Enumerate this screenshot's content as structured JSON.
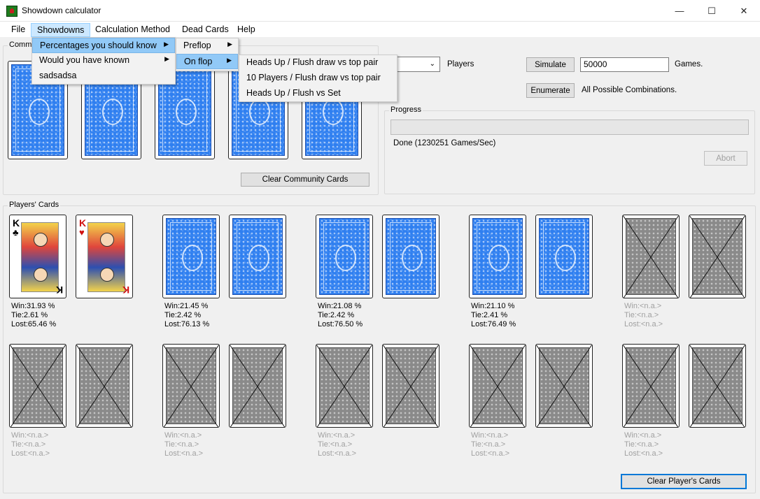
{
  "window": {
    "title": "Showdown calculator",
    "minimize": "—",
    "maximize": "☐",
    "close": "✕"
  },
  "menubar": [
    "File",
    "Showdowns",
    "Calculation Method",
    "Dead Cards",
    "Help"
  ],
  "menus": {
    "showdowns": [
      "Percentages you should know",
      "Would you have known",
      "sadsadsa"
    ],
    "percentages": [
      "Preflop",
      "On flop"
    ],
    "on_flop": [
      "Heads Up / Flush draw vs top pair",
      "10 Players / Flush draw vs top pair",
      "Heads Up / Flush vs Set"
    ]
  },
  "community": {
    "label": "Commu",
    "clear_button": "Clear Community Cards",
    "cards": [
      "back",
      "back",
      "back",
      "back",
      "back"
    ]
  },
  "controls": {
    "players_label": "Players",
    "simulate_button": "Simulate",
    "games_value": "50000",
    "games_label": "Games.",
    "enumerate_button": "Enumerate",
    "enumerate_label": "All Possible Combinations."
  },
  "progress": {
    "label": "Progress",
    "fraction": 0,
    "status": "Done (1230251 Games/Sec)",
    "abort_button": "Abort"
  },
  "players": {
    "label": "Players' Cards",
    "clear_button": "Clear Player's Cards",
    "list": [
      {
        "cards": [
          {
            "rank": "K",
            "suit": "♣",
            "color": "#000000"
          },
          {
            "rank": "K",
            "suit": "♥",
            "color": "#d01010"
          }
        ],
        "win": "Win:31.93 %",
        "tie": "Tie:2.61 %",
        "lost": "Lost:65.46 %",
        "active": true
      },
      {
        "cards": [
          "back",
          "back"
        ],
        "win": "Win:21.45 %",
        "tie": "Tie:2.42 %",
        "lost": "Lost:76.13 %",
        "active": true
      },
      {
        "cards": [
          "back",
          "back"
        ],
        "win": "Win:21.08 %",
        "tie": "Tie:2.42 %",
        "lost": "Lost:76.50 %",
        "active": true
      },
      {
        "cards": [
          "back",
          "back"
        ],
        "win": "Win:21.10 %",
        "tie": "Tie:2.41 %",
        "lost": "Lost:76.49 %",
        "active": true
      },
      {
        "cards": [
          "disabled",
          "disabled"
        ],
        "win": "Win:<n.a.>",
        "tie": "Tie:<n.a.>",
        "lost": "Lost:<n.a.>",
        "active": false
      },
      {
        "cards": [
          "disabled",
          "disabled"
        ],
        "win": "Win:<n.a.>",
        "tie": "Tie:<n.a.>",
        "lost": "Lost:<n.a.>",
        "active": false
      },
      {
        "cards": [
          "disabled",
          "disabled"
        ],
        "win": "Win:<n.a.>",
        "tie": "Tie:<n.a.>",
        "lost": "Lost:<n.a.>",
        "active": false
      },
      {
        "cards": [
          "disabled",
          "disabled"
        ],
        "win": "Win:<n.a.>",
        "tie": "Tie:<n.a.>",
        "lost": "Lost:<n.a.>",
        "active": false
      },
      {
        "cards": [
          "disabled",
          "disabled"
        ],
        "win": "Win:<n.a.>",
        "tie": "Tie:<n.a.>",
        "lost": "Lost:<n.a.>",
        "active": false
      },
      {
        "cards": [
          "disabled",
          "disabled"
        ],
        "win": "Win:<n.a.>",
        "tie": "Tie:<n.a.>",
        "lost": "Lost:<n.a.>",
        "active": false
      }
    ]
  },
  "colors": {
    "card_back": "#2f7ff0",
    "menu_highlight": "#91c9f7",
    "focus": "#0078d7"
  }
}
